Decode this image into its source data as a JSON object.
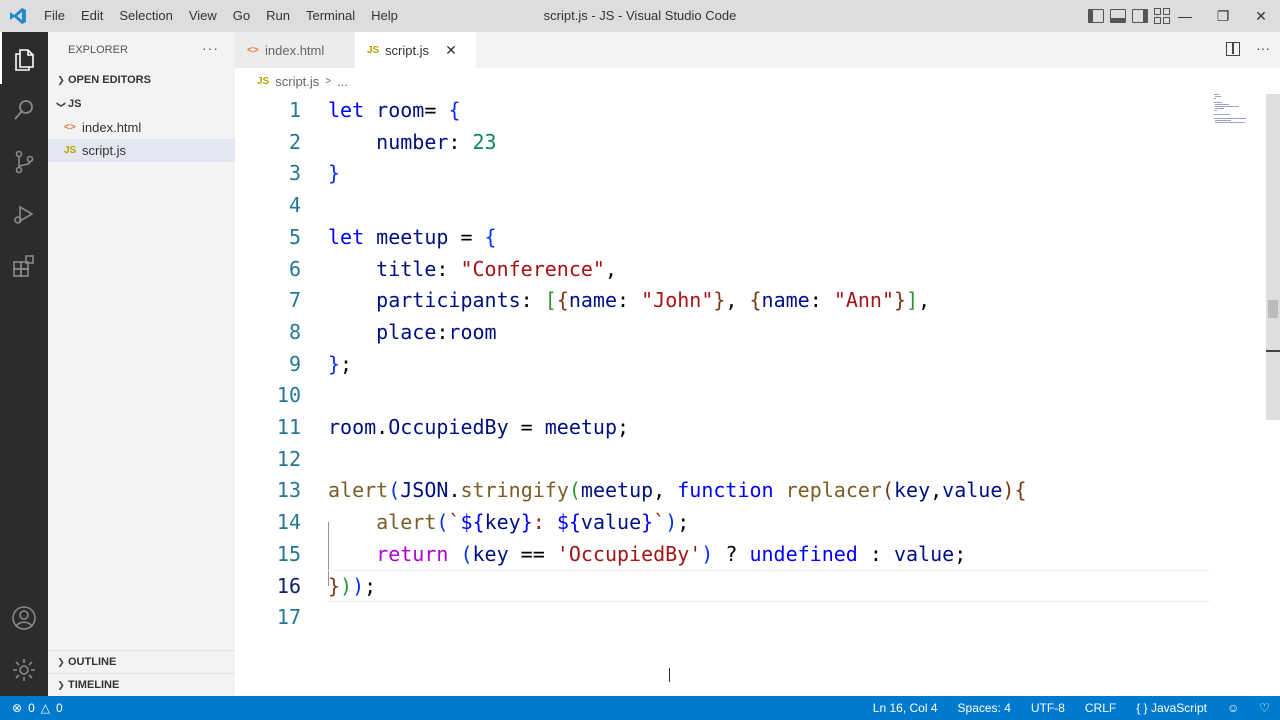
{
  "titlebar": {
    "menu": [
      "File",
      "Edit",
      "Selection",
      "View",
      "Go",
      "Run",
      "Terminal",
      "Help"
    ],
    "title": "script.js - JS - Visual Studio Code"
  },
  "sidebar": {
    "explorer_title": "EXPLORER",
    "open_editors": "OPEN EDITORS",
    "folder": "JS",
    "files": [
      {
        "name": "index.html",
        "icon": "<>"
      },
      {
        "name": "script.js",
        "icon": "JS"
      }
    ],
    "outline": "OUTLINE",
    "timeline": "TIMELINE"
  },
  "tabs": [
    {
      "label": "index.html",
      "icon": "<>"
    },
    {
      "label": "script.js",
      "icon": "JS"
    }
  ],
  "breadcrumb": {
    "icon": "JS",
    "file": "script.js",
    "sep": ">",
    "rest": "..."
  },
  "editor": {
    "current_line": 16,
    "lines": [
      {
        "n": "1",
        "tokens": [
          [
            "let ",
            "#0000ff"
          ],
          [
            "room",
            "#001080"
          ],
          [
            "= ",
            "#000000"
          ],
          [
            "{",
            "#0431fa"
          ]
        ]
      },
      {
        "n": "2",
        "tokens": [
          [
            "    number",
            "#001080"
          ],
          [
            ": ",
            "#000000"
          ],
          [
            "23",
            "#098658"
          ]
        ]
      },
      {
        "n": "3",
        "tokens": [
          [
            "}",
            "#0431fa"
          ]
        ]
      },
      {
        "n": "4",
        "tokens": []
      },
      {
        "n": "5",
        "tokens": [
          [
            "let ",
            "#0000ff"
          ],
          [
            "meetup",
            "#001080"
          ],
          [
            " = ",
            "#000000"
          ],
          [
            "{",
            "#0431fa"
          ]
        ]
      },
      {
        "n": "6",
        "tokens": [
          [
            "    title",
            "#001080"
          ],
          [
            ": ",
            "#000000"
          ],
          [
            "\"Conference\"",
            "#a31515"
          ],
          [
            ",",
            "#000000"
          ]
        ]
      },
      {
        "n": "7",
        "tokens": [
          [
            "    participants",
            "#001080"
          ],
          [
            ": ",
            "#000000"
          ],
          [
            "[",
            "#319331"
          ],
          [
            "{",
            "#7b3814"
          ],
          [
            "name",
            "#001080"
          ],
          [
            ": ",
            "#000000"
          ],
          [
            "\"John\"",
            "#a31515"
          ],
          [
            "}",
            "#7b3814"
          ],
          [
            ", ",
            "#000000"
          ],
          [
            "{",
            "#7b3814"
          ],
          [
            "name",
            "#001080"
          ],
          [
            ": ",
            "#000000"
          ],
          [
            "\"Ann\"",
            "#a31515"
          ],
          [
            "}",
            "#7b3814"
          ],
          [
            "]",
            "#319331"
          ],
          [
            ",",
            "#000000"
          ]
        ]
      },
      {
        "n": "8",
        "tokens": [
          [
            "    place",
            "#001080"
          ],
          [
            ":",
            "#000000"
          ],
          [
            "room",
            "#001080"
          ]
        ]
      },
      {
        "n": "9",
        "tokens": [
          [
            "}",
            "#0431fa"
          ],
          [
            ";",
            "#000000"
          ]
        ]
      },
      {
        "n": "10",
        "tokens": []
      },
      {
        "n": "11",
        "tokens": [
          [
            "room",
            "#001080"
          ],
          [
            ".",
            "#000000"
          ],
          [
            "OccupiedBy",
            "#001080"
          ],
          [
            " = ",
            "#000000"
          ],
          [
            "meetup",
            "#001080"
          ],
          [
            ";",
            "#000000"
          ]
        ]
      },
      {
        "n": "12",
        "tokens": []
      },
      {
        "n": "13",
        "tokens": [
          [
            "alert",
            "#795e26"
          ],
          [
            "(",
            "#0431fa"
          ],
          [
            "JSON",
            "#001080"
          ],
          [
            ".",
            "#000000"
          ],
          [
            "stringify",
            "#795e26"
          ],
          [
            "(",
            "#319331"
          ],
          [
            "meetup",
            "#001080"
          ],
          [
            ", ",
            "#000000"
          ],
          [
            "function ",
            "#0000ff"
          ],
          [
            "replacer",
            "#795e26"
          ],
          [
            "(",
            "#7b3814"
          ],
          [
            "key",
            "#001080"
          ],
          [
            ",",
            "#000000"
          ],
          [
            "value",
            "#001080"
          ],
          [
            ")",
            "#7b3814"
          ],
          [
            "{",
            "#7b3814"
          ]
        ]
      },
      {
        "n": "14",
        "tokens": [
          [
            "    alert",
            "#795e26"
          ],
          [
            "(",
            "#0431fa"
          ],
          [
            "`",
            "#a31515"
          ],
          [
            "${",
            "#0000ff"
          ],
          [
            "key",
            "#001080"
          ],
          [
            "}",
            "#0000ff"
          ],
          [
            ": ",
            "#a31515"
          ],
          [
            "${",
            "#0000ff"
          ],
          [
            "value",
            "#001080"
          ],
          [
            "}",
            "#0000ff"
          ],
          [
            "`",
            "#a31515"
          ],
          [
            ")",
            "#0431fa"
          ],
          [
            ";",
            "#000000"
          ]
        ]
      },
      {
        "n": "15",
        "tokens": [
          [
            "    return ",
            "#af00db"
          ],
          [
            "(",
            "#0431fa"
          ],
          [
            "key",
            "#001080"
          ],
          [
            " == ",
            "#000000"
          ],
          [
            "'OccupiedBy'",
            "#a31515"
          ],
          [
            ")",
            "#0431fa"
          ],
          [
            " ? ",
            "#000000"
          ],
          [
            "undefined",
            "#0000ff"
          ],
          [
            " : ",
            "#000000"
          ],
          [
            "value",
            "#001080"
          ],
          [
            ";",
            "#000000"
          ]
        ]
      },
      {
        "n": "16",
        "tokens": [
          [
            "}",
            "#7b3814"
          ],
          [
            ")",
            "#319331"
          ],
          [
            ")",
            "#0431fa"
          ],
          [
            ";",
            "#000000"
          ]
        ]
      },
      {
        "n": "17",
        "tokens": []
      }
    ]
  },
  "statusbar": {
    "errors": "0",
    "warnings": "0",
    "position": "Ln 16, Col 4",
    "spaces": "Spaces: 4",
    "encoding": "UTF-8",
    "eol": "CRLF",
    "language": "JavaScript"
  },
  "colors": {
    "accent": "#007acc",
    "activitybar": "#2c2c2c",
    "sidebar": "#f3f3f3"
  }
}
